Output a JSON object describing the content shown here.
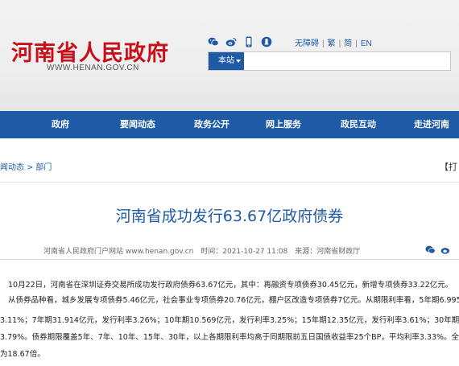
{
  "header": {
    "logo_text": "河南省人民政府",
    "logo_url": "WWW.HENAN.GOV.CN",
    "social_icons": [
      "wechat-icon",
      "weibo-icon",
      "mobile-icon",
      "app-icon"
    ],
    "links": [
      "无障碍",
      "繁",
      "简",
      "EN"
    ],
    "search_scope": "本站",
    "search_placeholder": "",
    "accent": "#c9101a"
  },
  "nav": {
    "color": "#1f5aa6",
    "items": [
      "政府",
      "要闻动态",
      "政务公开",
      "网上服务",
      "政民互动",
      "走进河南"
    ]
  },
  "breadcrumb": [
    "闻动态",
    "部门"
  ],
  "print_label": "【打",
  "article": {
    "title": "河南省成功发行63.67亿政府债券",
    "source_site": "河南省人民政府门户网站 www.henan.gov.cn",
    "date": "时间：2021-10-27 11:08",
    "source": "来源：河南省财政厅",
    "paragraphs": [
      "10月22日，河南省在深圳证券交易所成功发行政府债券63.67亿元，其中：再融资专项债券30.45亿元，新增专项债券33.22亿元。",
      "从债券品种看，城乡发展专项债券5.46亿元，社会事业专项债券20.76亿元，棚户区改造专项债券7亿元。从期限利率看，5年期6.995",
      "3.11%；7年期31.914亿元，发行利率3.26%；10年期10.569亿元，发行利率3.25%；15年期12.35亿元，发行利率3.61%；30年期1.84",
      "3.79%。债券期限覆盖5年、7年、10年、15年、30年，以上各期限利率均高于同期限前五日国债收益率25个BP，平均利率3.33%。全场",
      "为18.67倍。"
    ]
  }
}
